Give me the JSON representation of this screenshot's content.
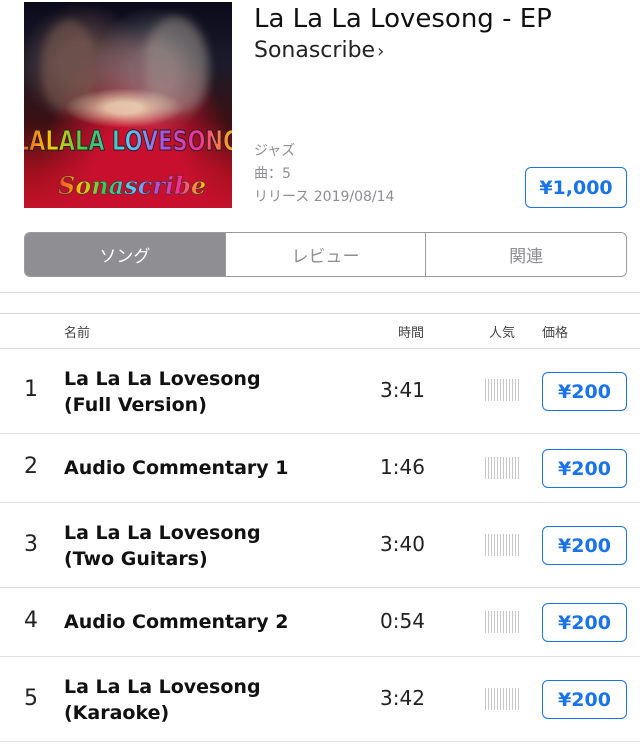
{
  "album": {
    "title": "La La La Lovesong - EP",
    "artist": "Sonascribe",
    "genre": "ジャズ",
    "track_count": "曲：5",
    "release": "リリース 2019/08/14",
    "price": "¥1,000",
    "artwork_text": [
      "LALALA LOVESONG",
      "Sonascribe"
    ]
  },
  "tabs": [
    {
      "label": "ソング",
      "active": true
    },
    {
      "label": "レビュー",
      "active": false
    },
    {
      "label": "関連",
      "active": false
    }
  ],
  "table": {
    "headers": {
      "name": "名前",
      "time": "時間",
      "popularity": "人気",
      "price": "価格"
    },
    "tracks": [
      {
        "number": "1",
        "title_line1": "La La La Lovesong",
        "title_line2": "(Full Version)",
        "time": "3:41",
        "price": "¥200"
      },
      {
        "number": "2",
        "title_line1": "Audio Commentary 1",
        "title_line2": "",
        "time": "1:46",
        "price": "¥200"
      },
      {
        "number": "3",
        "title_line1": "La La La Lovesong",
        "title_line2": "(Two Guitars)",
        "time": "3:40",
        "price": "¥200"
      },
      {
        "number": "4",
        "title_line1": "Audio Commentary 2",
        "title_line2": "",
        "time": "0:54",
        "price": "¥200"
      },
      {
        "number": "5",
        "title_line1": "La La La Lovesong",
        "title_line2": "(Karaoke)",
        "time": "3:42",
        "price": "¥200"
      }
    ]
  },
  "colors": {
    "accent": "#1a73e8",
    "segment_active": "#8e8e93"
  },
  "icons": {
    "artist_link": "chevron-right-icon",
    "popularity": "popularity-bars-icon"
  }
}
